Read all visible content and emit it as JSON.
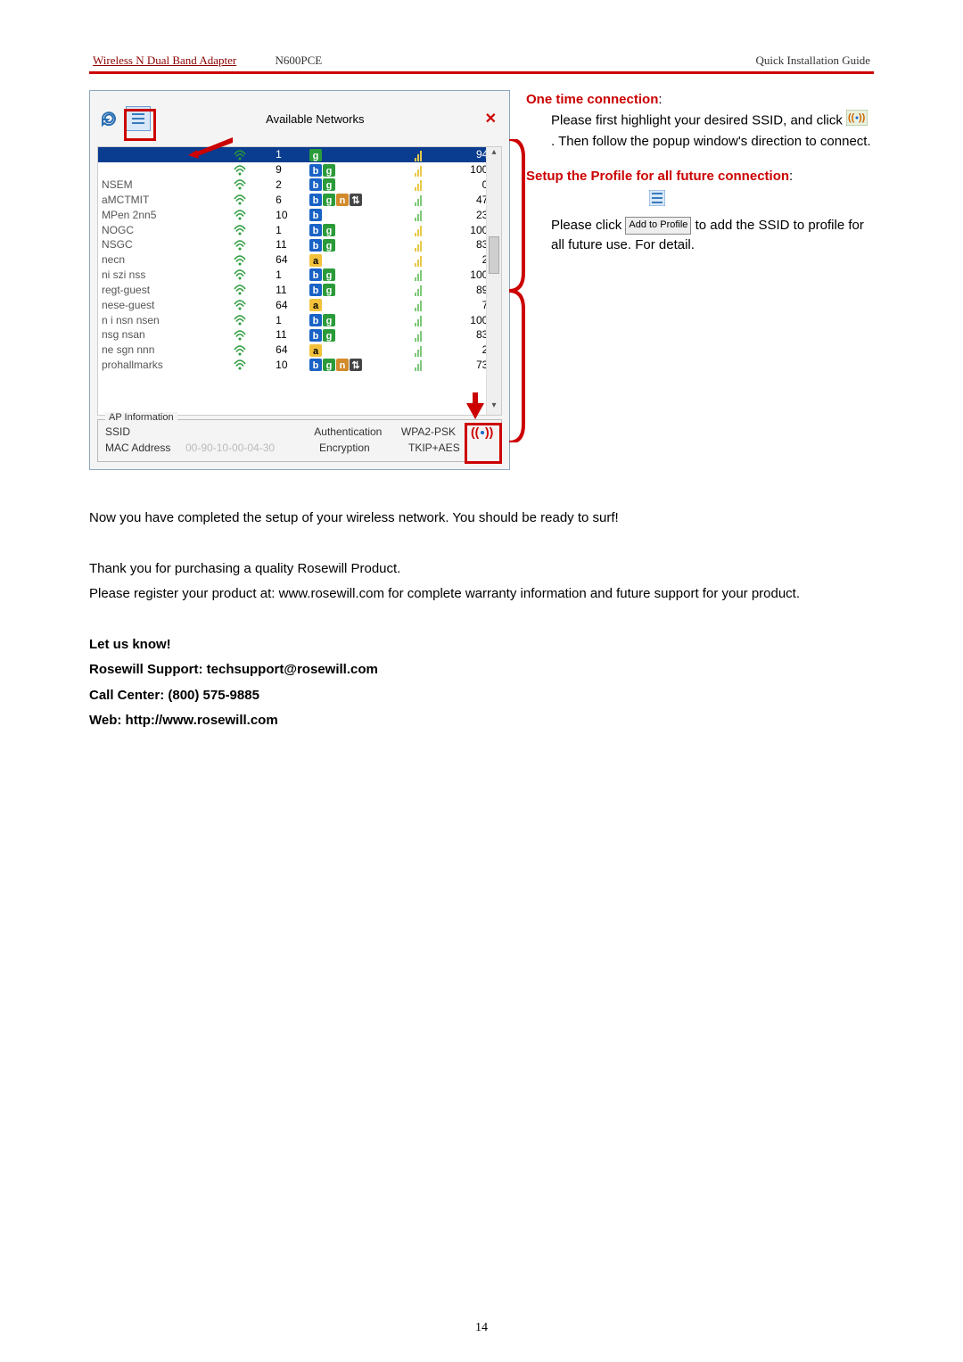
{
  "header": {
    "product_link": "Wireless N Dual Band Adapter",
    "model": "N600PCE",
    "guide_label": "Quick Installation Guide"
  },
  "window": {
    "title": "Available Networks",
    "close_glyph": "✕"
  },
  "networks": [
    {
      "ssid": "",
      "ch": "1",
      "a": false,
      "b": false,
      "g": true,
      "n": false,
      "wps": false,
      "lock": true,
      "signal": "94%",
      "selected": true
    },
    {
      "ssid": "",
      "ch": "9",
      "a": false,
      "b": true,
      "g": true,
      "n": false,
      "wps": false,
      "lock": true,
      "signal": "100%",
      "selected": false
    },
    {
      "ssid": "NSEM",
      "ch": "2",
      "a": false,
      "b": true,
      "g": true,
      "n": false,
      "wps": false,
      "lock": true,
      "signal": "0%",
      "selected": false
    },
    {
      "ssid": "aMCTMIT",
      "ch": "6",
      "a": false,
      "b": true,
      "g": true,
      "n": true,
      "wps": true,
      "lock": false,
      "signal": "47%",
      "selected": false
    },
    {
      "ssid": "MPen 2nn5",
      "ch": "10",
      "a": false,
      "b": true,
      "g": false,
      "n": false,
      "wps": false,
      "lock": false,
      "signal": "23%",
      "selected": false
    },
    {
      "ssid": "NOGC",
      "ch": "1",
      "a": false,
      "b": true,
      "g": true,
      "n": false,
      "wps": false,
      "lock": true,
      "signal": "100%",
      "selected": false
    },
    {
      "ssid": "NSGC",
      "ch": "11",
      "a": false,
      "b": true,
      "g": true,
      "n": false,
      "wps": false,
      "lock": true,
      "signal": "83%",
      "selected": false
    },
    {
      "ssid": "necn",
      "ch": "64",
      "a": true,
      "b": false,
      "g": false,
      "n": false,
      "wps": false,
      "lock": true,
      "signal": "2%",
      "selected": false
    },
    {
      "ssid": "ni szi nss",
      "ch": "1",
      "a": false,
      "b": true,
      "g": true,
      "n": false,
      "wps": false,
      "lock": false,
      "signal": "100%",
      "selected": false
    },
    {
      "ssid": "regt-guest",
      "ch": "11",
      "a": false,
      "b": true,
      "g": true,
      "n": false,
      "wps": false,
      "lock": false,
      "signal": "89%",
      "selected": false
    },
    {
      "ssid": "nese-guest",
      "ch": "64",
      "a": true,
      "b": false,
      "g": false,
      "n": false,
      "wps": false,
      "lock": false,
      "signal": "7%",
      "selected": false
    },
    {
      "ssid": "n i nsn nsen",
      "ch": "1",
      "a": false,
      "b": true,
      "g": true,
      "n": false,
      "wps": false,
      "lock": false,
      "signal": "100%",
      "selected": false
    },
    {
      "ssid": "nsg nsan",
      "ch": "11",
      "a": false,
      "b": true,
      "g": true,
      "n": false,
      "wps": false,
      "lock": false,
      "signal": "83%",
      "selected": false
    },
    {
      "ssid": "ne sgn nnn",
      "ch": "64",
      "a": true,
      "b": false,
      "g": false,
      "n": false,
      "wps": false,
      "lock": false,
      "signal": "2%",
      "selected": false
    },
    {
      "ssid": "prohallmarks",
      "ch": "10",
      "a": false,
      "b": true,
      "g": true,
      "n": true,
      "wps": true,
      "lock": false,
      "signal": "73%",
      "selected": false
    }
  ],
  "ap": {
    "legend": "AP Information",
    "ssid_label": "SSID",
    "ssid_value": "",
    "mac_label": "MAC Address",
    "mac_value": "00-90-10-00-04-30",
    "auth_label": "Authentication",
    "auth_value": "WPA2-PSK",
    "enc_label": "Encryption",
    "enc_value": "TKIP+AES"
  },
  "right": {
    "onetime_heading": "One time connection",
    "onetime_line1": "Please first highlight your desired SSID, and click ",
    "onetime_line2": ". Then follow the popup window's direction to connect.",
    "setup_heading": "Setup the Profile for all future connection",
    "setup_line1": "Please click ",
    "setup_line2": " to add the SSID to profile for all future use. For detail.",
    "addprofile_label": "Add to Profile"
  },
  "body": {
    "completed": "Now you have completed the setup of your wireless network. You should be ready to surf!",
    "thank": "Thank you for purchasing a quality Rosewill Product.",
    "register": "Please register your product at: www.rosewill.com for complete warranty information and future support for your product.",
    "letus": "Let us know!",
    "support": "Rosewill Support: techsupport@rosewill.com",
    "call": "Call Center: (800) 575-9885",
    "web": "Web: http://www.rosewill.com"
  },
  "page_number": "14"
}
